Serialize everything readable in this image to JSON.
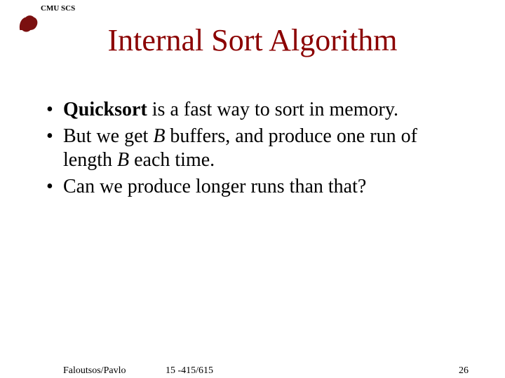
{
  "header": {
    "org": "CMU SCS"
  },
  "title": "Internal Sort Algorithm",
  "bullets": [
    {
      "parts": [
        {
          "text": "Quicksort",
          "style": "bold"
        },
        {
          "text": " is a fast way to sort in memory.",
          "style": ""
        }
      ]
    },
    {
      "parts": [
        {
          "text": "But we get ",
          "style": ""
        },
        {
          "text": "B",
          "style": "italic"
        },
        {
          "text": " buffers, and produce one run of length ",
          "style": ""
        },
        {
          "text": "B",
          "style": "italic"
        },
        {
          "text": " each time.",
          "style": ""
        }
      ]
    },
    {
      "parts": [
        {
          "text": "Can we produce longer runs than that?",
          "style": ""
        }
      ]
    }
  ],
  "footer": {
    "authors": "Faloutsos/Pavlo",
    "course": "15 -415/615",
    "page": "26"
  }
}
